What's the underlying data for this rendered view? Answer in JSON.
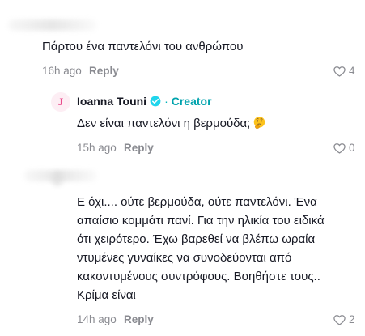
{
  "comments": [
    {
      "text": "Πάρτου ένα παντελόνι του ανθρώπου",
      "time": "16h ago",
      "reply_label": "Reply",
      "likes": "4"
    },
    {
      "author": "Ioanna Touni",
      "avatar_letter": "J",
      "creator_separator": "·",
      "creator_label": "Creator",
      "text": "Δεν είναι παντελόνι η βερμούδα;",
      "emoji": "thinking-face-emoji",
      "time": "15h ago",
      "reply_label": "Reply",
      "likes": "0"
    },
    {
      "lines": [
        "Ε όχι.... ούτε βερμούδα, ούτε παντελόνι. Ένα",
        "απαίσιο κομμάτι πανί. Για την ηλικία του ειδικά",
        "ότι χειρότερο. Έχω βαρεθεί να βλέπω ωραία",
        "ντυμένες γυναίκες να συνοδεύονται από",
        "κακοντυμένους συντρόφους. Βοηθήστε τους..",
        "Κρίμα είναι"
      ],
      "time": "14h ago",
      "reply_label": "Reply",
      "likes": "2"
    }
  ],
  "colors": {
    "text": "#161823",
    "meta": "#8a8b91",
    "creator_accent": "#00a3ad",
    "verified": "#20d5ec"
  }
}
